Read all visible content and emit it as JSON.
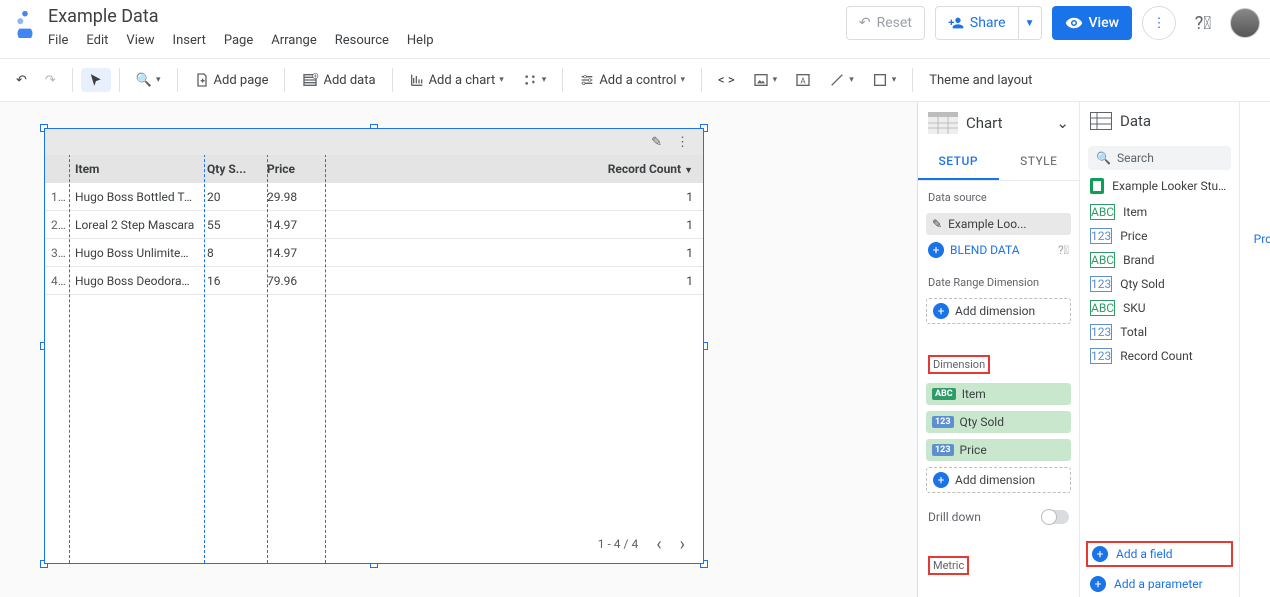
{
  "doc": {
    "title": "Example Data"
  },
  "menus": [
    "File",
    "Edit",
    "View",
    "Insert",
    "Page",
    "Arrange",
    "Resource",
    "Help"
  ],
  "topbar": {
    "reset": "Reset",
    "share": "Share",
    "view": "View"
  },
  "toolbar": {
    "addPage": "Add page",
    "addData": "Add data",
    "addChart": "Add a chart",
    "addControl": "Add a control",
    "themeLayout": "Theme and layout"
  },
  "chart_table": {
    "headers": {
      "item": "Item",
      "qty": "Qty S...",
      "price": "Price",
      "rc": "Record Count"
    },
    "rows": [
      {
        "idx": "1...",
        "item": "Hugo Boss Bottled To...",
        "qty": "20",
        "price": "29.98",
        "rc": "1"
      },
      {
        "idx": "2...",
        "item": "Loreal 2 Step Mascara",
        "qty": "55",
        "price": "14.97",
        "rc": "1"
      },
      {
        "idx": "3...",
        "item": "Hugo Boss Unlimited ...",
        "qty": "8",
        "price": "14.97",
        "rc": "1"
      },
      {
        "idx": "4...",
        "item": "Hugo Boss Deodorant...",
        "qty": "16",
        "price": "79.96",
        "rc": "1"
      }
    ],
    "pager": "1 - 4 / 4"
  },
  "chartPanel": {
    "title": "Chart",
    "tabs": {
      "setup": "SETUP",
      "style": "STYLE"
    },
    "dataSourceLabel": "Data source",
    "dataSource": "Example Loo...",
    "blend": "BLEND DATA",
    "dateRange": "Date Range Dimension",
    "addDim": "Add dimension",
    "dimension": "Dimension",
    "dims": {
      "item": "Item",
      "qty": "Qty Sold",
      "price": "Price"
    },
    "drill": "Drill down",
    "metric": "Metric"
  },
  "dataPanel": {
    "title": "Data",
    "searchPlaceholder": "Search",
    "source": "Example Looker Studio...",
    "fields": {
      "item": "Item",
      "price": "Price",
      "brand": "Brand",
      "qty": "Qty Sold",
      "sku": "SKU",
      "total": "Total",
      "rc": "Record Count"
    },
    "addField": "Add a field",
    "addParam": "Add a parameter"
  },
  "stub": {
    "pro": "Pro"
  }
}
